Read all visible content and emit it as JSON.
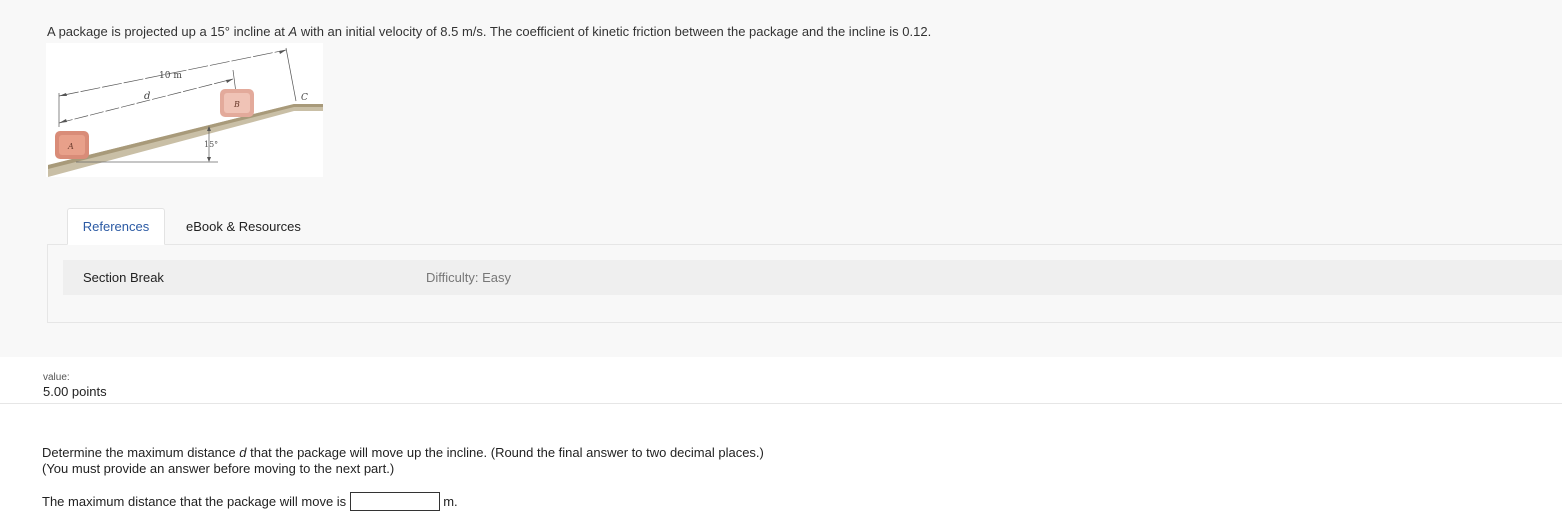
{
  "problem": {
    "text_before_A": "A package is projected up a 15° incline at ",
    "point_label": "A",
    "text_after_A": " with an initial velocity of 8.5 m/s. The coefficient of kinetic friction between the package and the incline is 0.12."
  },
  "figure": {
    "dim_top": "10 m",
    "dim_bottom": "d",
    "point_A": "A",
    "point_B": "B",
    "point_C": "C",
    "angle": "15°"
  },
  "tabs": {
    "references": "References",
    "ebook": "eBook & Resources"
  },
  "section": {
    "label": "Section Break",
    "difficulty": "Difficulty: Easy"
  },
  "value": {
    "label": "value:",
    "points": "5.00 points"
  },
  "question": {
    "line1_before": "Determine the maximum distance ",
    "line1_var": "d",
    "line1_after": " that the package will move up the incline. (Round the final answer to two decimal places.)",
    "line2": "(You must provide an answer before moving to the next part.)"
  },
  "answer": {
    "prefix": "The maximum distance that the package will move is",
    "value": "",
    "unit": "m."
  }
}
